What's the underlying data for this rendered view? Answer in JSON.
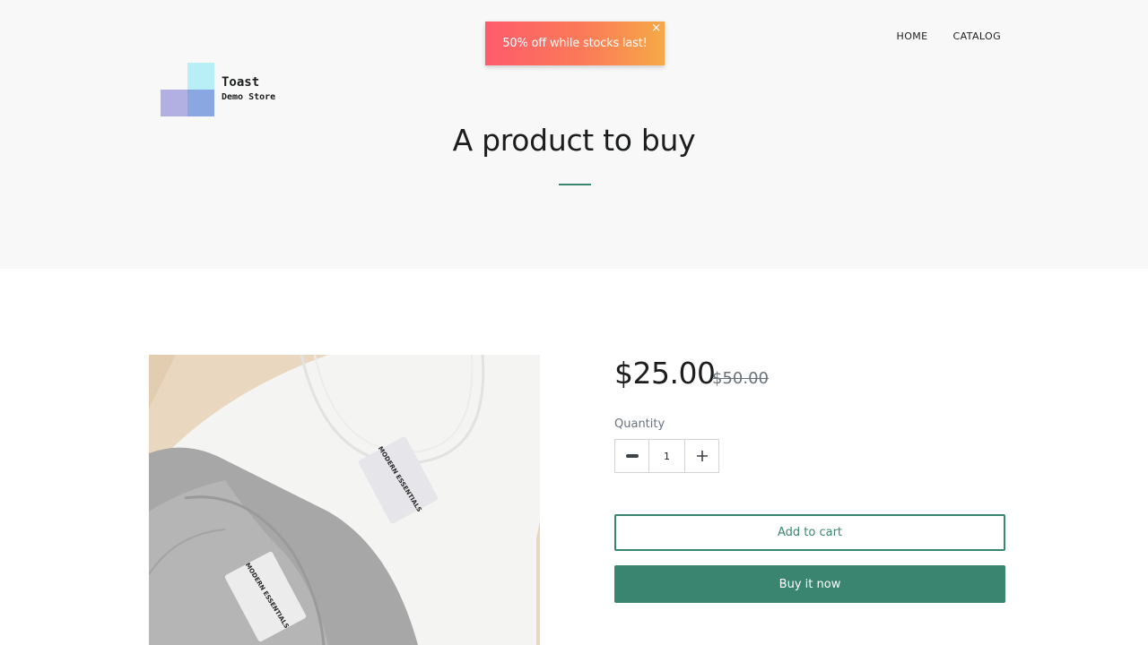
{
  "toast": {
    "message": "50% off while stocks last!",
    "close_glyph": "×"
  },
  "nav": {
    "items": [
      {
        "label": "HOME"
      },
      {
        "label": "CATALOG"
      }
    ]
  },
  "brand": {
    "name": "Toast",
    "subtitle": "Demo Store"
  },
  "page": {
    "title": "A product to buy"
  },
  "product": {
    "image_icon": "t-shirts-photo",
    "tag_text": "MODERN ESSENTIALS",
    "price": "$25.00",
    "compare_price": "$50.00",
    "quantity_label": "Quantity",
    "quantity_value": "1",
    "add_to_cart_label": "Add to cart",
    "buy_now_label": "Buy it now"
  },
  "colors": {
    "accent": "#3a8570",
    "hero_bg": "#f8f8f8",
    "toast_gradient_start": "#fe5b6b",
    "toast_gradient_end": "#f6a947"
  }
}
